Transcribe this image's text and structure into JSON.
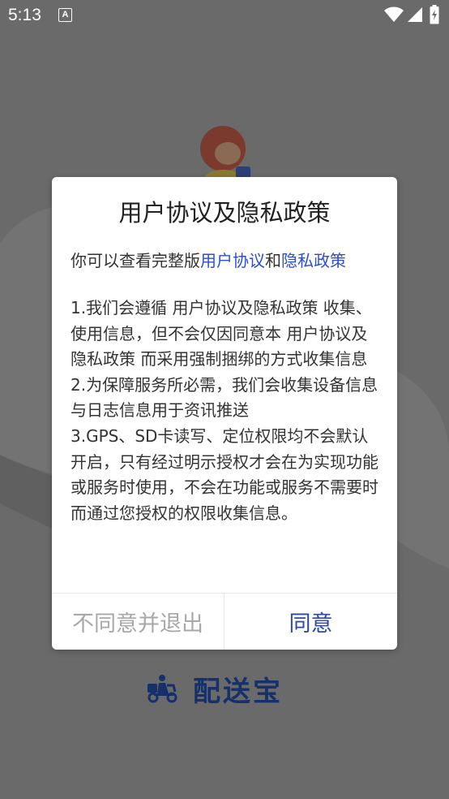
{
  "status_bar": {
    "time": "5:13",
    "notification_icon_letter": "A",
    "icons": [
      "a-notification-icon",
      "wifi-icon",
      "signal-icon",
      "battery-charging-icon"
    ]
  },
  "background": {
    "logo_text": "配送宝",
    "overlay_color": "#6a6a6a"
  },
  "dialog": {
    "title": "用户协议及隐私政策",
    "intro_prefix": "你可以查看完整版",
    "user_agreement_link": "用户协议",
    "intro_and": "和",
    "privacy_policy_link": "隐私政策",
    "paragraphs": [
      "1.我们会遵循 用户协议及隐私政策 收集、使用信息，但不会仅因同意本 用户协议及隐私政策 而采用强制捆绑的方式收集信息",
      "2.为保障服务所必需，我们会收集设备信息与日志信息用于资讯推送",
      "3.GPS、SD卡读写、定位权限均不会默认开启，只有经过明示授权才会在为实现功能或服务时使用，不会在功能或服务不需要时而通过您授权的权限收集信息。"
    ],
    "decline_label": "不同意并退出",
    "agree_label": "同意"
  },
  "colors": {
    "link": "#2c4fcf",
    "agree": "#2a48a6",
    "decline": "#a8a8a8",
    "logo": "#15306a"
  }
}
